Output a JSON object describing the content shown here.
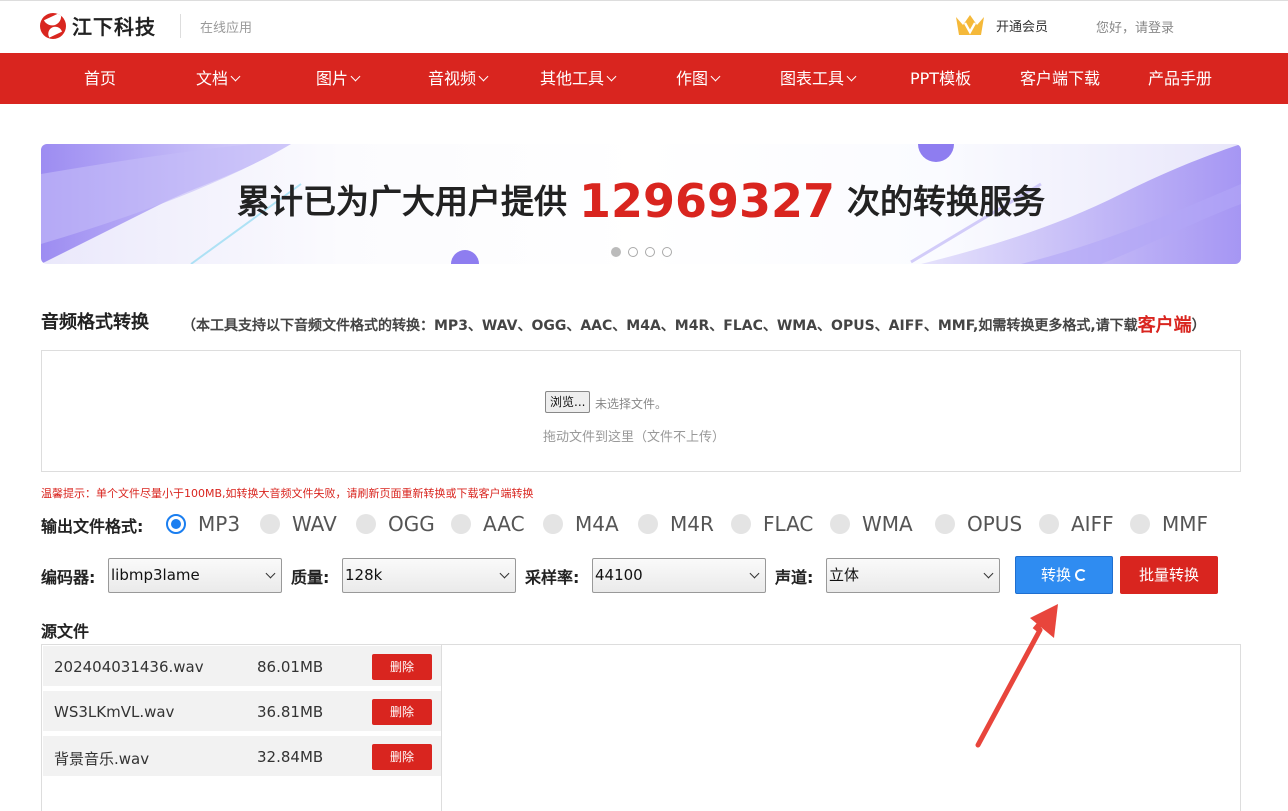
{
  "header": {
    "brand": "江下科技",
    "subtitle": "在线应用",
    "vip_label": "开通会员",
    "login_label": "您好，请登录"
  },
  "nav": {
    "items": [
      {
        "label": "首页",
        "dropdown": false
      },
      {
        "label": "文档",
        "dropdown": true
      },
      {
        "label": "图片",
        "dropdown": true
      },
      {
        "label": "音视频",
        "dropdown": true
      },
      {
        "label": "其他工具",
        "dropdown": true
      },
      {
        "label": "作图",
        "dropdown": true
      },
      {
        "label": "图表工具",
        "dropdown": true
      },
      {
        "label": "PPT模板",
        "dropdown": false
      },
      {
        "label": "客户端下载",
        "dropdown": false
      },
      {
        "label": "产品手册",
        "dropdown": false
      }
    ]
  },
  "banner": {
    "text_before": "累计已为广大用户提供",
    "count": "12969327",
    "text_after": "次的转换服务",
    "slide_count": 4,
    "active_slide": 1
  },
  "tool": {
    "title": "音频格式转换",
    "desc_prefix": "（本工具支持以下音频文件格式的转换：MP3、WAV、OGG、AAC、M4A、M4R、FLAC、WMA、OPUS、AIFF、MMF,如需转换更多格式,请下载",
    "desc_link": "客户端",
    "desc_suffix": "）"
  },
  "upload": {
    "browse_label": "浏览...",
    "no_file_text": "未选择文件。",
    "drag_hint": "拖动文件到这里（文件不上传）"
  },
  "warm_tip": "温馨提示：单个文件尽量小于100MB,如转换大音频文件失败，请刷新页面重新转换或下载客户端转换",
  "format": {
    "label": "输出文件格式:",
    "options": [
      "MP3",
      "WAV",
      "OGG",
      "AAC",
      "M4A",
      "M4R",
      "FLAC",
      "WMA",
      "OPUS",
      "AIFF",
      "MMF"
    ],
    "selected": "MP3"
  },
  "options": {
    "encoder_label": "编码器:",
    "encoder_value": "libmp3lame",
    "quality_label": "质量:",
    "quality_value": "128k",
    "samplerate_label": "采样率:",
    "samplerate_value": "44100",
    "channel_label": "声道:",
    "channel_value": "立体",
    "convert_label": "转换",
    "batch_label": "批量转换"
  },
  "source": {
    "title": "源文件",
    "delete_label": "删除",
    "files": [
      {
        "name": "202404031436.wav",
        "size": "86.01MB"
      },
      {
        "name": "WS3LKmVL.wav",
        "size": "36.81MB"
      },
      {
        "name": "背景音乐.wav",
        "size": "32.84MB"
      }
    ]
  },
  "colors": {
    "brand_red": "#d9251f",
    "accent_blue": "#2f8cf1",
    "banner_purple": "#9b8cf5"
  }
}
